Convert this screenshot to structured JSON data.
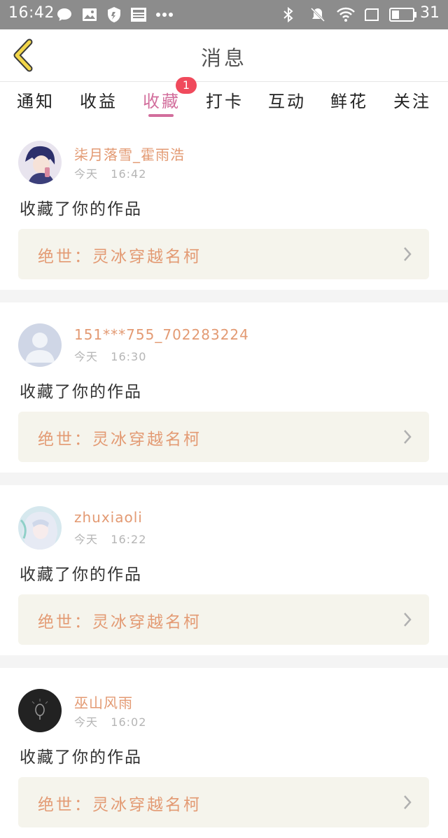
{
  "statusbar": {
    "time": "16:42",
    "battery": "31",
    "icons": [
      "chat-icon",
      "image-icon",
      "shield-icon",
      "news-icon",
      "more-dots-icon",
      "bluetooth-icon",
      "mute-icon",
      "wifi-icon",
      "screen-icon",
      "battery-icon"
    ]
  },
  "header": {
    "title": "消息",
    "back_icon": "chevron-left-icon"
  },
  "tabs": [
    {
      "label": "通知"
    },
    {
      "label": "收益"
    },
    {
      "label": "收藏",
      "active": true,
      "badge": "1"
    },
    {
      "label": "打卡"
    },
    {
      "label": "互动"
    },
    {
      "label": "鲜花"
    },
    {
      "label": "关注"
    }
  ],
  "colors": {
    "accent": "#d26e9c",
    "name": "#e39a73",
    "badge": "#f04a5c",
    "box": "#f5f4ec"
  },
  "items": [
    {
      "username": "柒月落雪_霍雨浩",
      "day": "今天",
      "time": "16:42",
      "message": "收藏了你的作品",
      "work": "绝世：灵冰穿越名柯"
    },
    {
      "username": "151***755_702283224",
      "day": "今天",
      "time": "16:30",
      "message": "收藏了你的作品",
      "work": "绝世：灵冰穿越名柯"
    },
    {
      "username": "zhuxiaoli",
      "day": "今天",
      "time": "16:22",
      "message": "收藏了你的作品",
      "work": "绝世：灵冰穿越名柯"
    },
    {
      "username": "巫山风雨",
      "day": "今天",
      "time": "16:02",
      "message": "收藏了你的作品",
      "work": "绝世：灵冰穿越名柯"
    }
  ]
}
